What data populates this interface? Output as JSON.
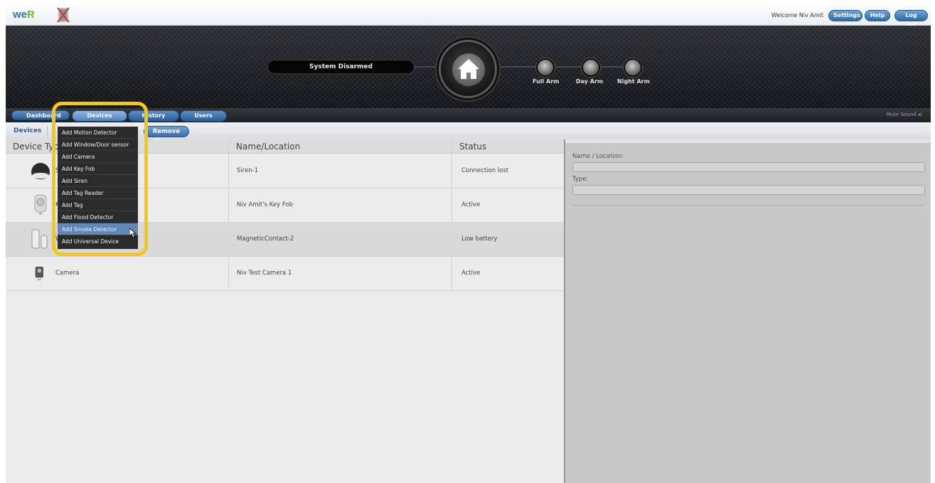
{
  "header": {
    "logo_text": "we",
    "logo_accent": "R",
    "welcome": "Welcome  Niv Amit",
    "settings_label": "Settings",
    "help_label": "Help",
    "logout_label": "Log out"
  },
  "banner": {
    "status": "System Disarmed",
    "arm_buttons": [
      "Full Arm",
      "Day Arm",
      "Night Arm"
    ]
  },
  "nav": {
    "tabs": [
      "Dashboard",
      "Devices",
      "History",
      "Users"
    ],
    "active": "Devices",
    "mute": "Mute Sound"
  },
  "subbar": {
    "breadcrumb": "Devices",
    "remove_label": "Remove Device"
  },
  "table": {
    "headers": [
      "Device Type",
      "Name/Location",
      "Status"
    ],
    "rows": [
      {
        "icon": "siren-icon",
        "type": "Siren",
        "name": "Siren-1",
        "status": "Connection lost"
      },
      {
        "icon": "key-fob-icon",
        "type": "Key Fob",
        "name": "Niv Amit's Key Fob",
        "status": "Active"
      },
      {
        "icon": "door-contact-icon",
        "type": "Window/Door sensor",
        "name": "MagneticContact-2",
        "status": "Low battery"
      },
      {
        "icon": "camera-icon",
        "type": "Camera",
        "name": "Niv Test Camera 1",
        "status": "Active"
      }
    ]
  },
  "details": {
    "name_label": "Name / Location:",
    "type_label": "Type:"
  },
  "dropdown": {
    "items": [
      "Add Motion Detector",
      "Add Window/Door sensor",
      "Add Camera",
      "Add Key Fob",
      "Add Siren",
      "Add Tag Reader",
      "Add Tag",
      "Add Flood Detector",
      "Add Smoke Detector",
      "Add Universal Device"
    ],
    "highlighted": "Add Smoke Detector"
  },
  "colors": {
    "accent": "#3a6ea8",
    "highlight_frame": "#f6c813",
    "banner_bg": "#161718"
  }
}
